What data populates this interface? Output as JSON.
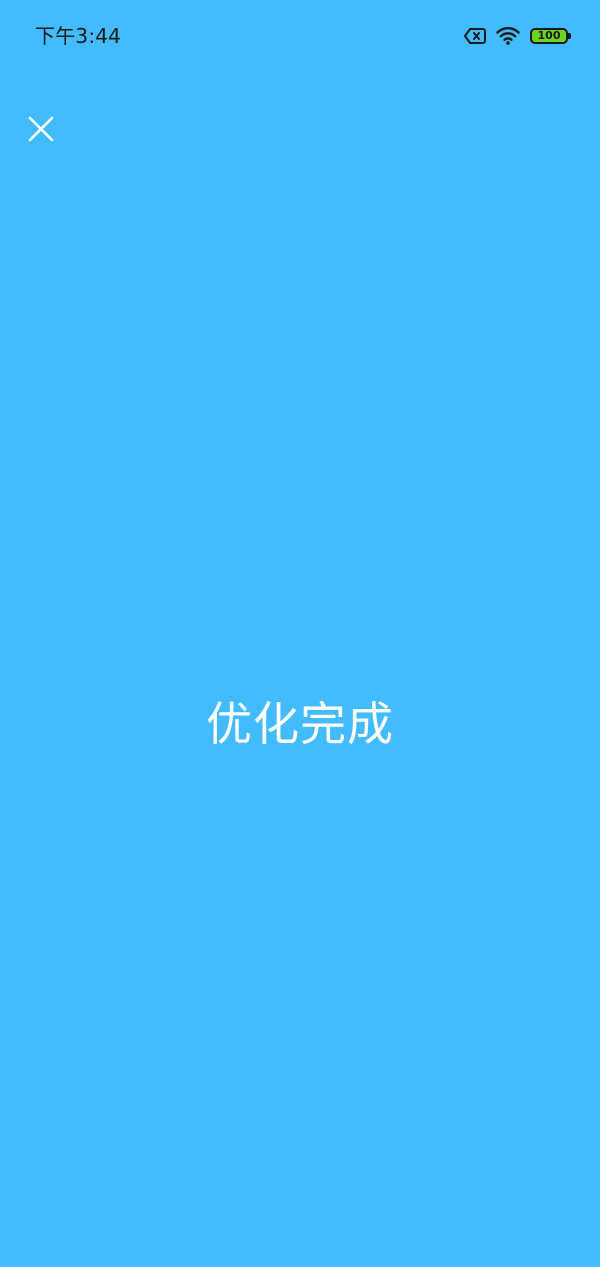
{
  "status_bar": {
    "time": "下午3:44",
    "battery_level": "100",
    "icons": [
      "sim-error-icon",
      "wifi-icon",
      "battery-icon"
    ]
  },
  "toolbar": {
    "close_icon": "close-icon"
  },
  "main": {
    "result_text": "优化完成"
  },
  "colors": {
    "background": "#42BBFF",
    "status_text": "#1a1a1a",
    "battery_fill": "#6BD425",
    "foreground": "#ffffff"
  }
}
